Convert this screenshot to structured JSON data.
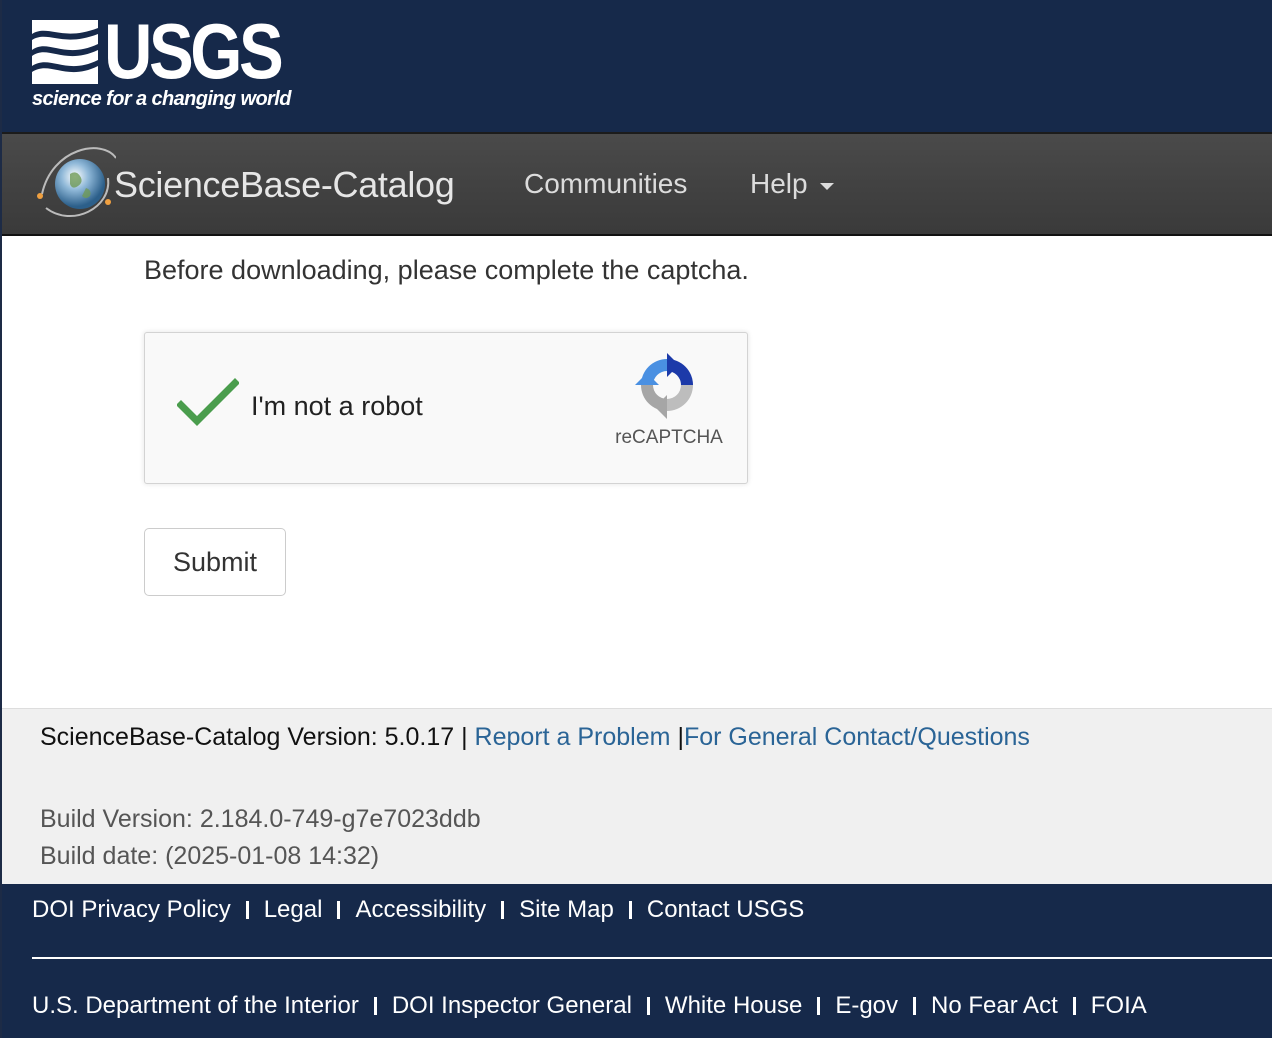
{
  "header": {
    "logo_word": "USGS",
    "tagline": "science for a changing world"
  },
  "navbar": {
    "brand": "ScienceBase-Catalog",
    "communities": "Communities",
    "help": "Help"
  },
  "main": {
    "instructions": "Before downloading, please complete the captcha.",
    "captcha": {
      "label": "I'm not a robot",
      "provider": "reCAPTCHA",
      "checked": true
    },
    "submit_label": "Submit"
  },
  "version_footer": {
    "version_text": "ScienceBase-Catalog Version: 5.0.17 |",
    "report_link": "Report a Problem",
    "pipe": "|",
    "contact_link": "For General Contact/Questions",
    "build_version": "Build Version: 2.184.0-749-g7e7023ddb",
    "build_date": "Build date: (2025-01-08 14:32)"
  },
  "gov_footer": {
    "row1": [
      "DOI Privacy Policy",
      "Legal",
      "Accessibility",
      "Site Map",
      "Contact USGS"
    ],
    "row2": [
      "U.S. Department of the Interior",
      "DOI Inspector General",
      "White House",
      "E-gov",
      "No Fear Act",
      "FOIA"
    ]
  },
  "colors": {
    "header_bg": "#16294a",
    "navbar_bg": "#404040",
    "link": "#2a6496",
    "check_green": "#4a9d4d"
  }
}
